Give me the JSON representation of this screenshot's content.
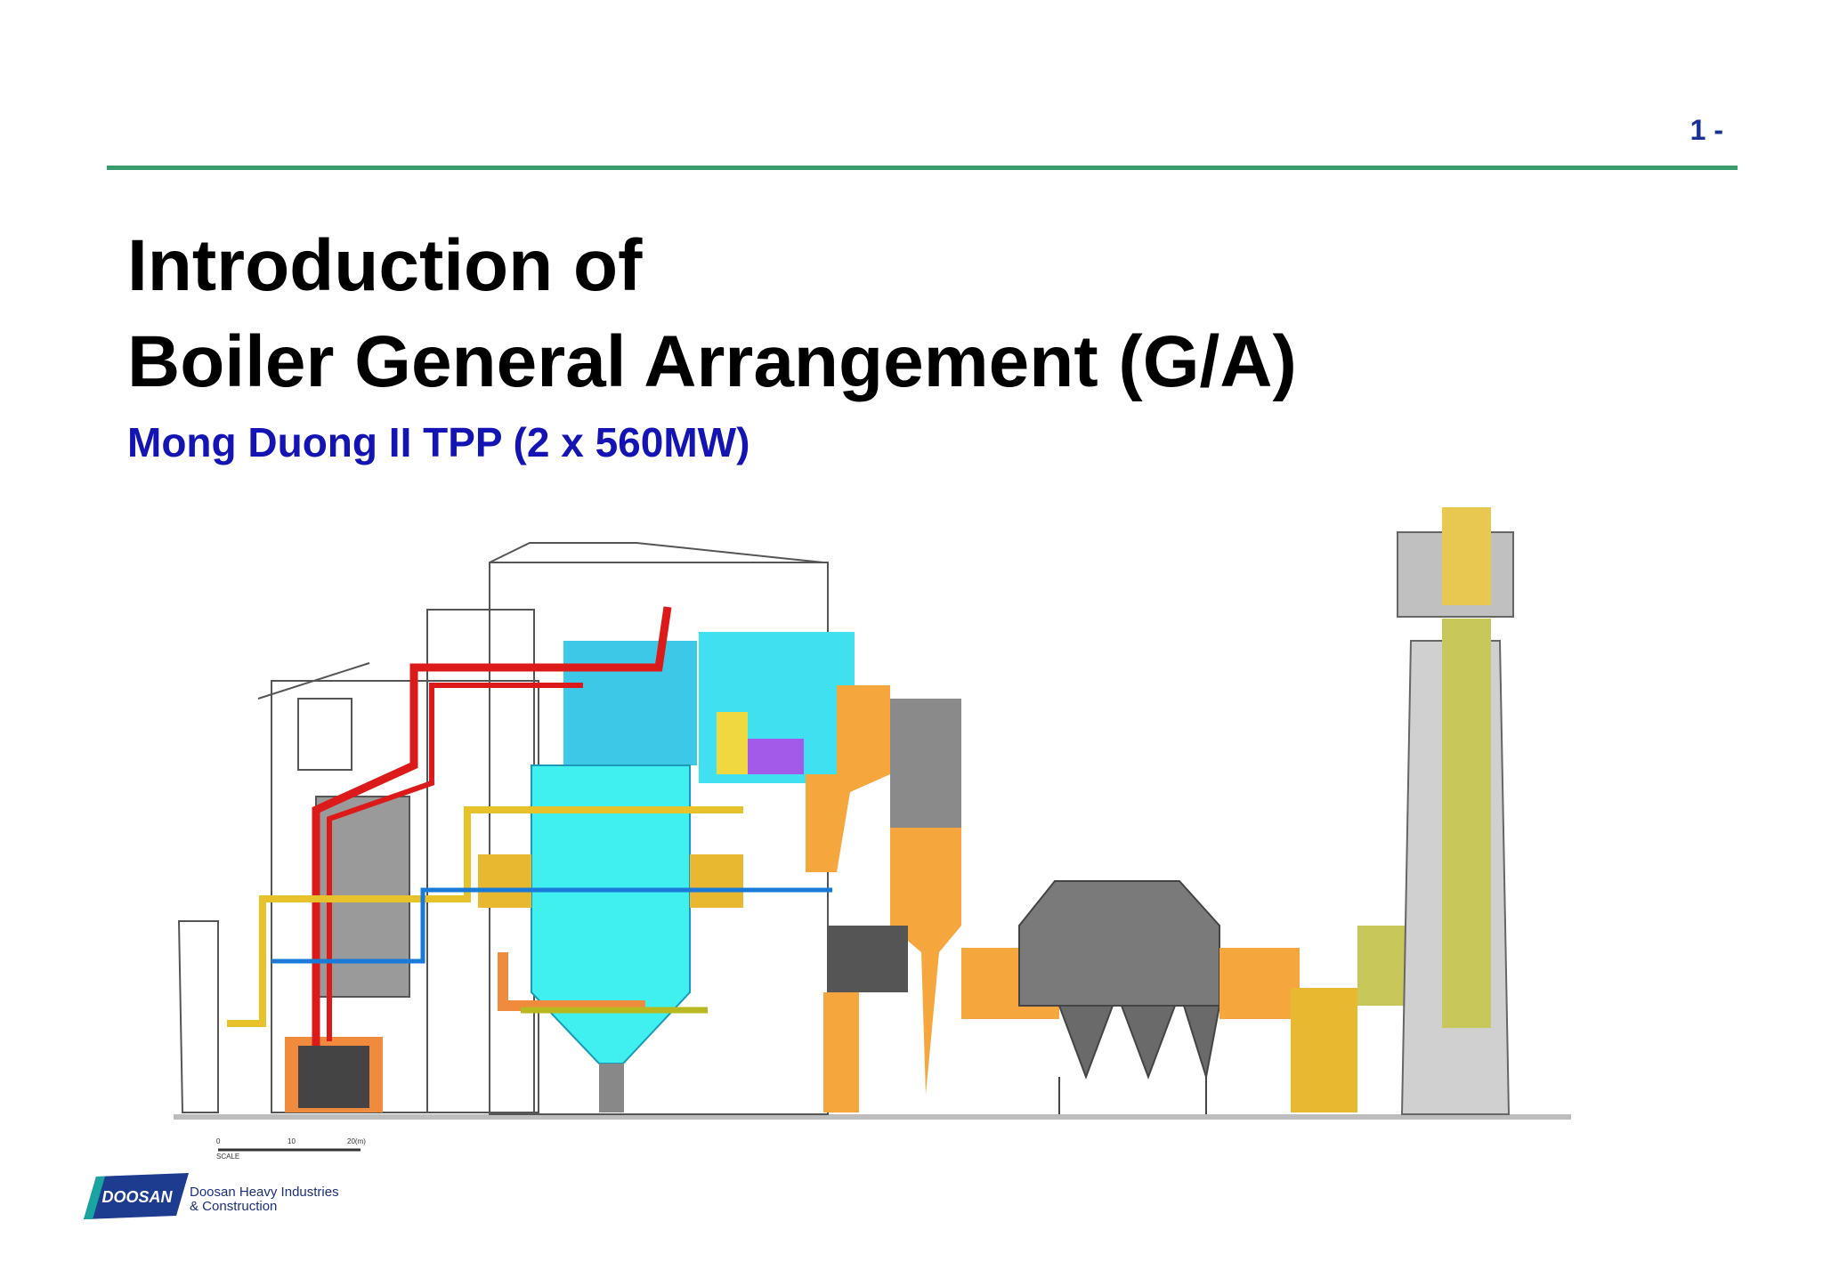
{
  "page": {
    "number": "1 -"
  },
  "title": {
    "line1": "Introduction of",
    "line2": "Boiler General Arrangement (G/A)",
    "subtitle": "Mong Duong II TPP (2 x 560MW)"
  },
  "diagram": {
    "scale": {
      "label": "SCALE",
      "ticks": [
        "0",
        "10",
        "20(m)"
      ]
    }
  },
  "footer": {
    "logo_text": "DOOSAN",
    "company_line1": "Doosan Heavy Industries",
    "company_line2": "& Construction"
  },
  "colors": {
    "header_rule": "#3a9a6e",
    "page_number": "#1a3296",
    "subtitle": "#1414b4",
    "furnace": "#40f0f0",
    "hot_pipe": "#dd1a1a",
    "feed_pipe": "#e8c22a",
    "cold_pipe": "#1a7ad8",
    "ductwork": "#f5a63c",
    "precipitator": "#7a7a7a",
    "stack_liner": "#c8c85a"
  }
}
